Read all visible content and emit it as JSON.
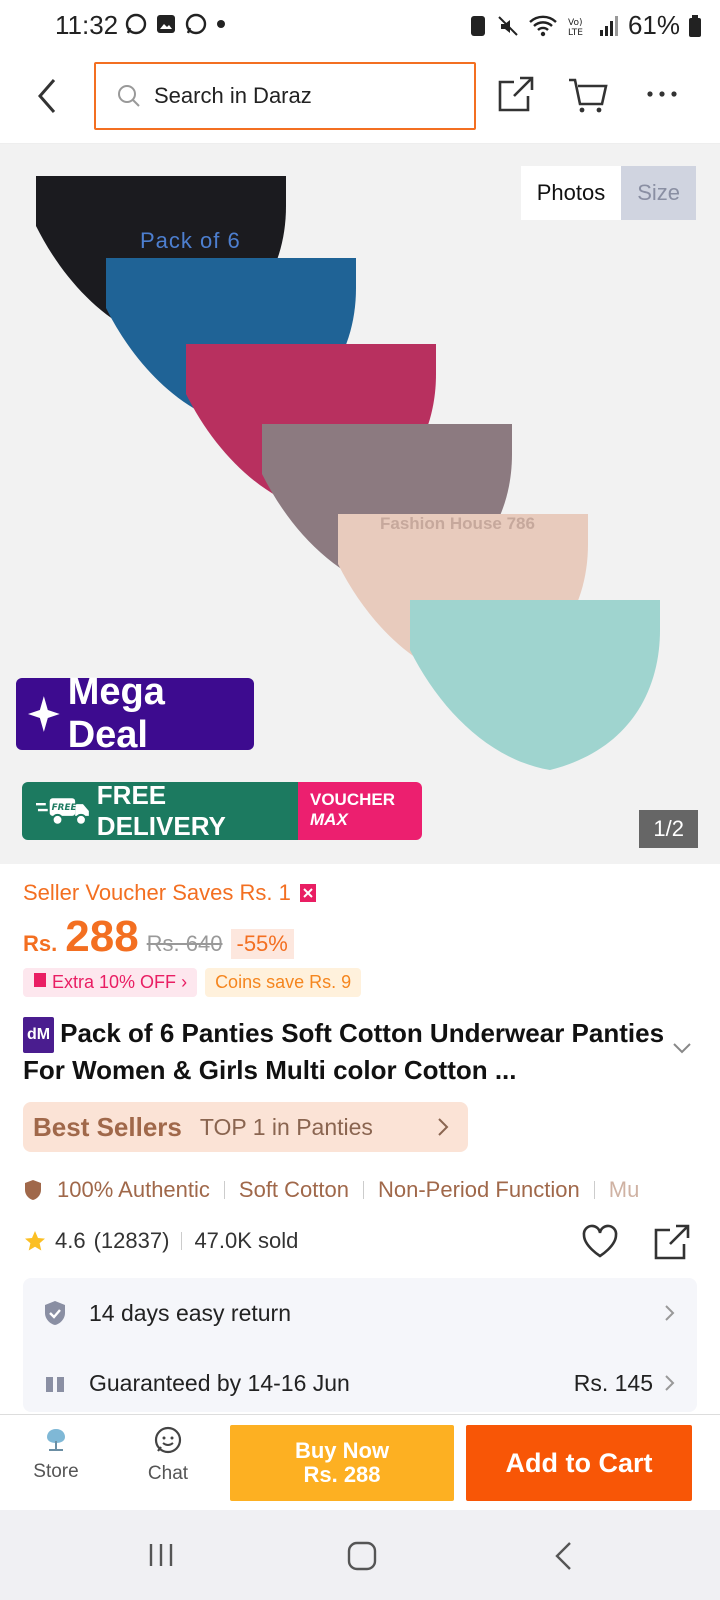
{
  "status_bar": {
    "time": "11:32",
    "battery": "61%"
  },
  "search": {
    "placeholder": "Search in Daraz"
  },
  "gallery": {
    "toggle_photos": "Photos",
    "toggle_size": "Size",
    "pack_label": "Pack of 6",
    "watermark": "Fashion House 786",
    "mega_deal": "Mega Deal",
    "free_badge": "FREE",
    "free_delivery": "FREE DELIVERY",
    "voucher_line1": "VOUCHER",
    "voucher_line2": "MAX",
    "pager": "1/2",
    "swatch_colors": [
      "#1b1b1f",
      "#1f6396",
      "#b8305f",
      "#8c7a80",
      "#e8cbbd",
      "#9fd4cf"
    ]
  },
  "product": {
    "seller_voucher": "Seller Voucher Saves Rs. 1",
    "currency": "Rs.",
    "price": "288",
    "original_price": "Rs. 640",
    "discount": "-55%",
    "extra_off": "Extra 10% OFF",
    "coins": "Coins save Rs. 9",
    "dm_badge": "dM",
    "title": "Pack of 6 Panties Soft Cotton Underwear Panties For Women & Girls Multi color Cotton ...",
    "best_sellers": "Best Sellers",
    "best_sellers_rank": "TOP 1 in Panties",
    "features": [
      "100% Authentic",
      "Soft Cotton",
      "Non-Period Function",
      "Mu"
    ],
    "rating": "4.6",
    "rating_count": "(12837)",
    "sold": "47.0K sold"
  },
  "services": {
    "return": "14 days easy return",
    "delivery": "Guaranteed by 14-16 Jun",
    "delivery_fee": "Rs. 145"
  },
  "bottom_bar": {
    "store": "Store",
    "chat": "Chat",
    "buy_now_line1": "Buy Now",
    "buy_now_line2": "Rs. 288",
    "add_to_cart": "Add to Cart"
  },
  "colors": {
    "accent": "#f36f21",
    "buy": "#fdb022",
    "cart": "#f85606"
  }
}
